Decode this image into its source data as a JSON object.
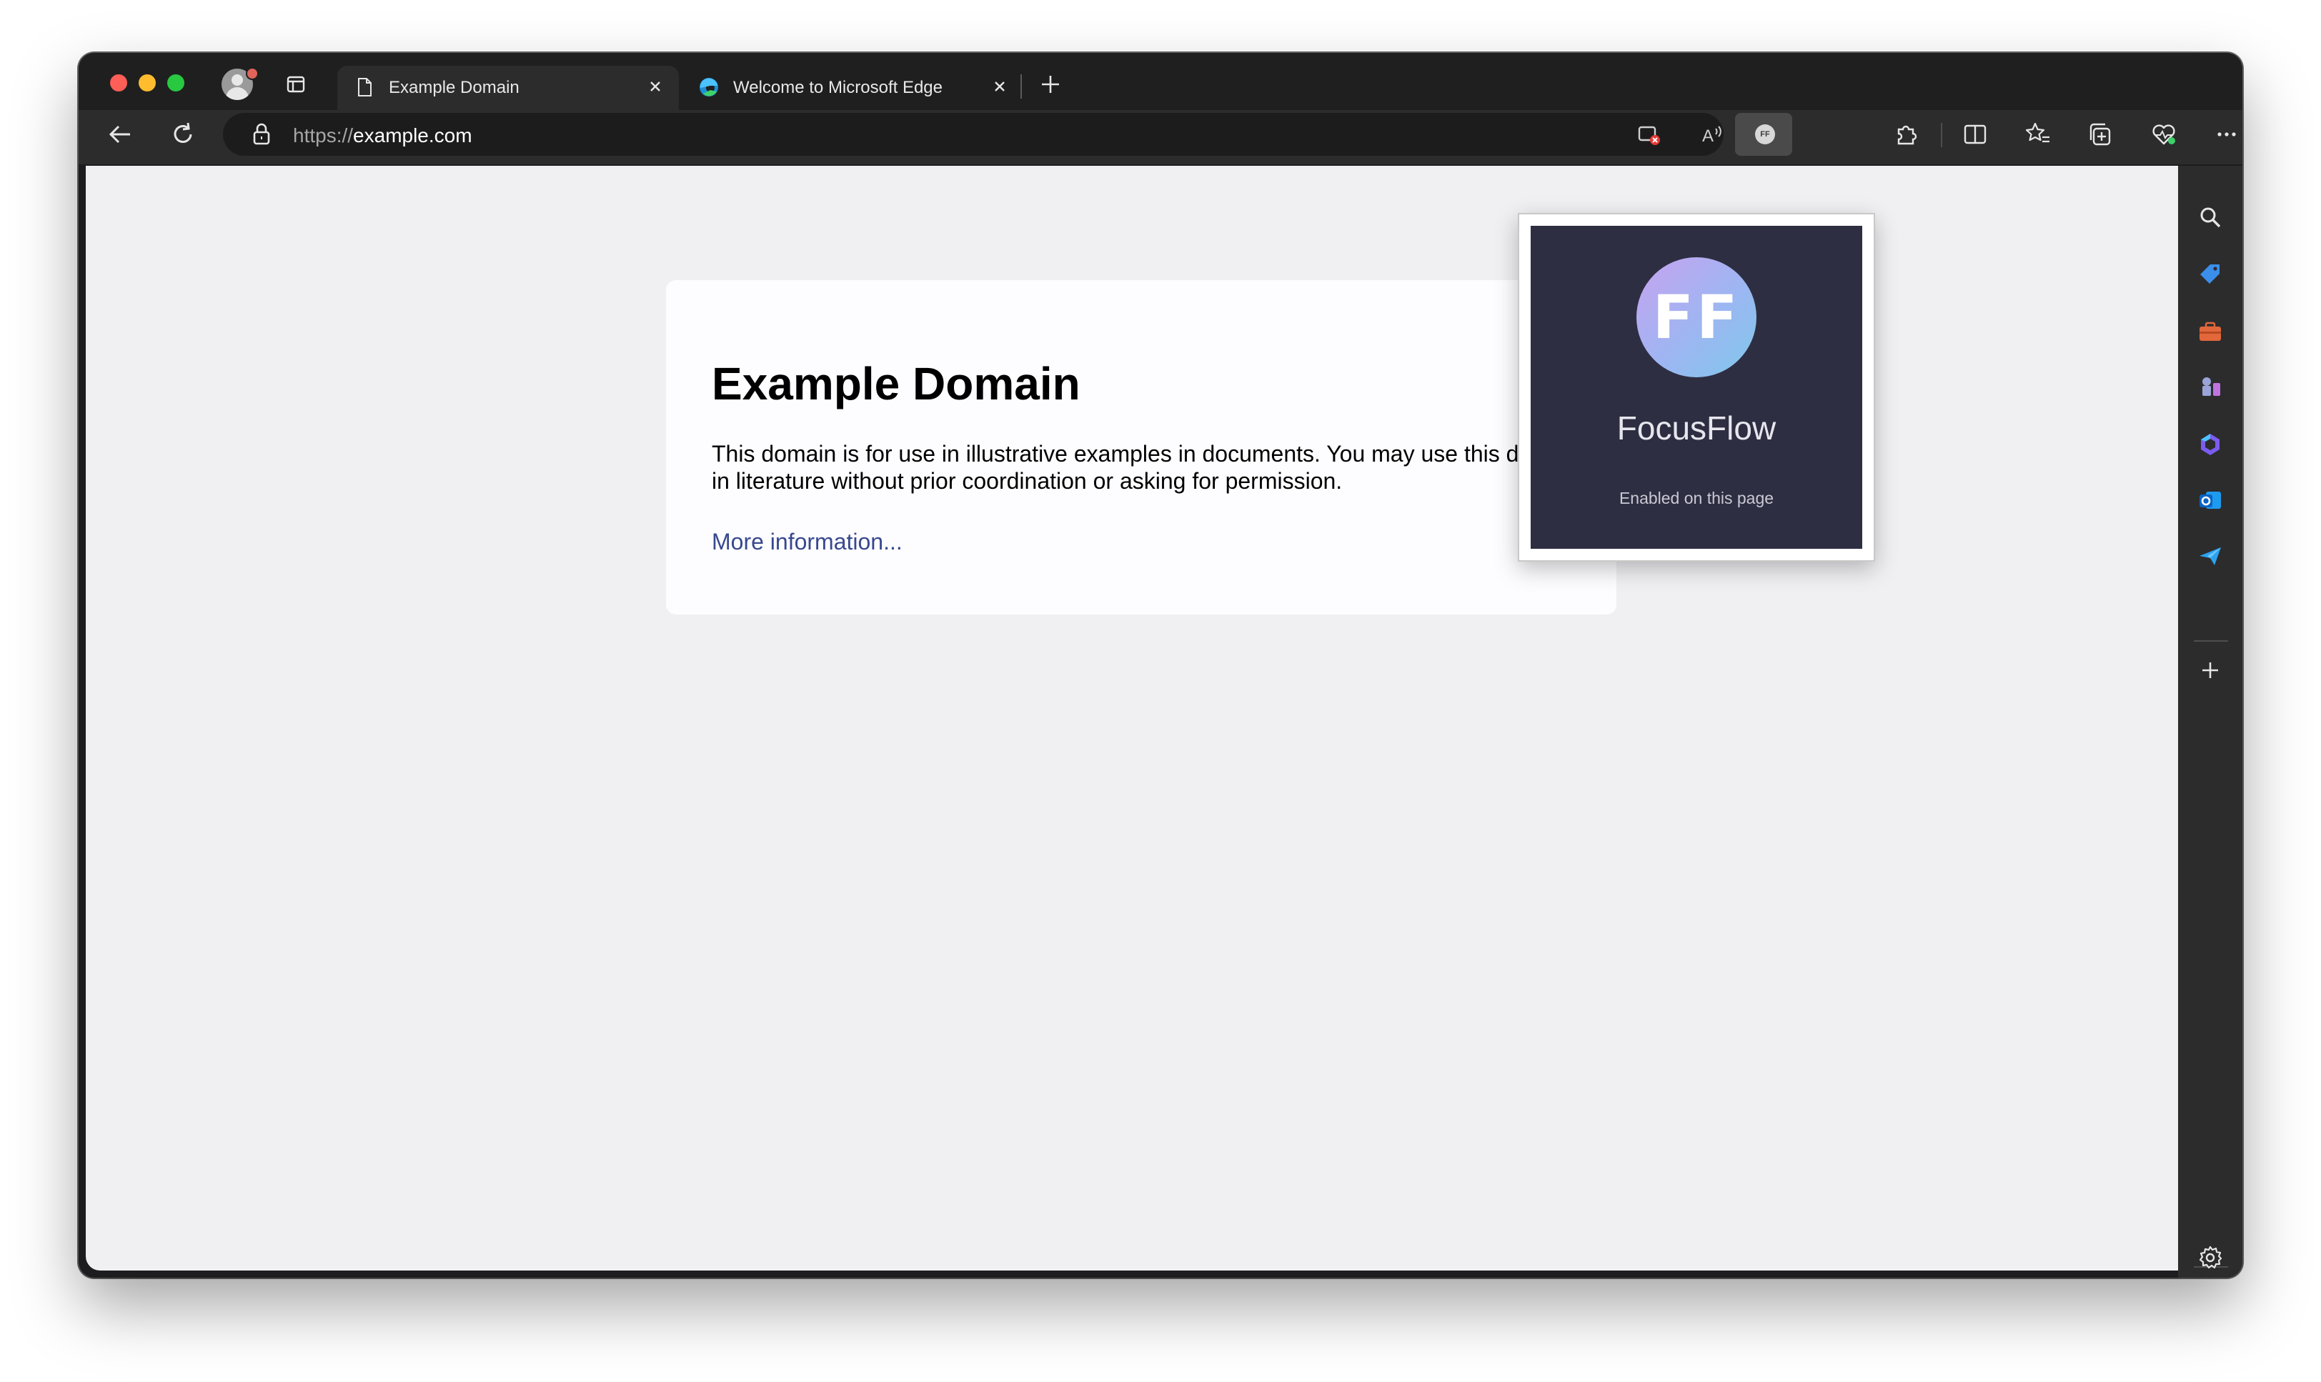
{
  "browser": {
    "tabs": [
      {
        "label": "Example Domain",
        "active": true,
        "favicon": "document-icon"
      },
      {
        "label": "Welcome to Microsoft Edge",
        "active": false,
        "favicon": "edge-logo-icon"
      }
    ],
    "address": {
      "scheme": "https://",
      "host": "example.com"
    },
    "extension_badge": "FF"
  },
  "page": {
    "heading": "Example Domain",
    "paragraph": "This domain is for use in illustrative examples in documents. You may use this domain in literature without prior coordination or asking for permission.",
    "link": "More information..."
  },
  "popup": {
    "logo_text": "FF",
    "title": "FocusFlow",
    "status": "Enabled on this page"
  },
  "colors": {
    "accent_link": "#38488f",
    "popup_bg": "#2e2e42",
    "traffic_red": "#ff5f57",
    "traffic_yellow": "#febc2e",
    "traffic_green": "#28c840"
  }
}
